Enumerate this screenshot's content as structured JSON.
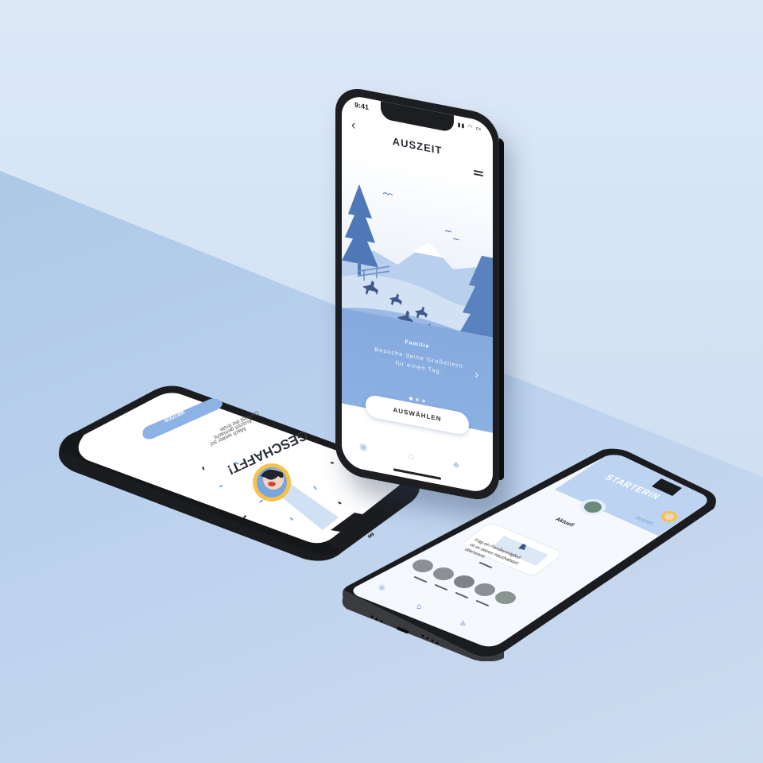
{
  "standing_phone": {
    "status_time": "9:41",
    "title": "AUSZEIT",
    "category": "Familie",
    "description": "Besuche deine Großeltern für einen Tag.",
    "select_label": "AUSWÄHLEN"
  },
  "left_phone": {
    "headline": "GESCHAFFT!",
    "line1": "Du hast die erste",
    "line2": "Auszeit gemacht.",
    "line3": "Mach weiter so!",
    "button_label": "WEITER"
  },
  "right_phone": {
    "title": "STARTERIN",
    "section_label": "Aktuell",
    "card_text_1": "Frag ein Familienmitglied",
    "card_text_2": "ob es deinen Haushaltsteil",
    "card_text_3": "übernimmt.",
    "top_link": "Auszeit"
  },
  "colors": {
    "accent": "#7aa4dc",
    "button_blue": "#8db3e6",
    "phone_body": "#1d1e21"
  },
  "icons": [
    "back-icon",
    "menu-icon",
    "chevron-right-icon",
    "chat-icon",
    "home-icon",
    "tree-icon",
    "avatar"
  ]
}
